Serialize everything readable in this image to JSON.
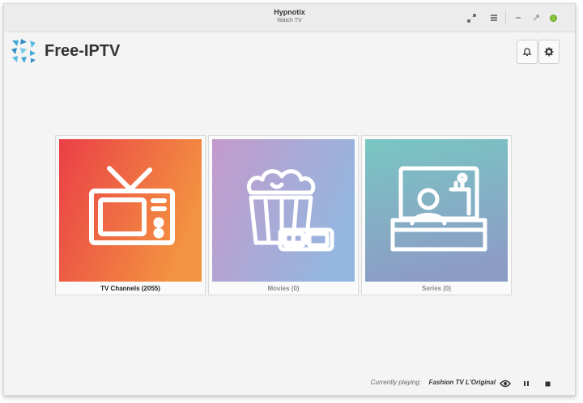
{
  "window": {
    "title": "Hypnotix",
    "subtitle": "Watch TV"
  },
  "header": {
    "app_name": "Free-IPTV"
  },
  "cards": [
    {
      "label": "TV Channels (2055)",
      "icon": "tv-icon",
      "gradient": [
        "#ea3f47",
        "#f39240"
      ],
      "label_color": "#222222"
    },
    {
      "label": "Movies (0)",
      "icon": "popcorn-icon",
      "gradient": [
        "#c49acb",
        "#95b6df"
      ],
      "label_color": "#8a8a8a"
    },
    {
      "label": "Series (0)",
      "icon": "series-icon",
      "gradient": [
        "#79c6c3",
        "#8c9dc5"
      ],
      "label_color": "#8a8a8a"
    }
  ],
  "status": {
    "label": "Currently playing:",
    "title": "Fashion TV L'Original"
  },
  "colors": {
    "accent_green": "#8cc63f",
    "logo_blue": "#3fa9d8"
  }
}
